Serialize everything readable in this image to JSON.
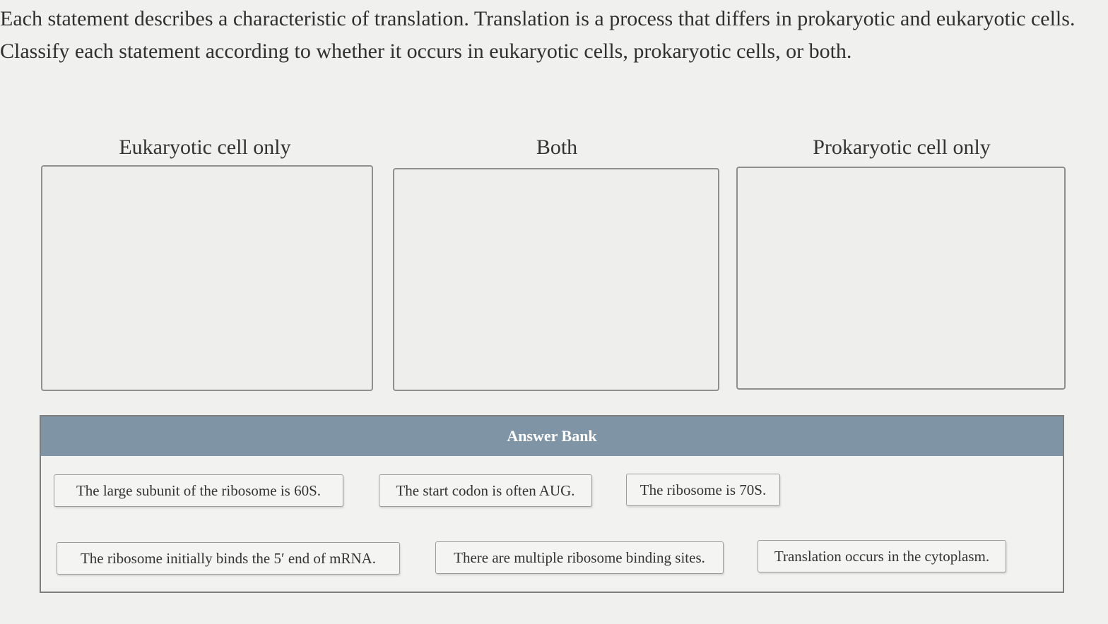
{
  "prompt": {
    "line1": "Each statement describes a characteristic of translation. Translation is a process that differs in prokaryotic and eukaryotic cells.",
    "line2": "Classify each statement according to whether it occurs in eukaryotic cells, prokaryotic cells, or both."
  },
  "bins": [
    {
      "label": "Eukaryotic cell only"
    },
    {
      "label": "Both"
    },
    {
      "label": "Prokaryotic cell only"
    }
  ],
  "answer_bank": {
    "title": "Answer Bank",
    "items": [
      {
        "text": "The large subunit of the ribosome is 60S."
      },
      {
        "text": "The start codon is often AUG."
      },
      {
        "text": "The ribosome is 70S."
      },
      {
        "text": "The ribosome initially binds the 5′ end of mRNA."
      },
      {
        "text": "There are multiple ribosome binding sites."
      },
      {
        "text": "Translation occurs in the cytoplasm."
      }
    ]
  },
  "colors": {
    "bank_header": "#7f95a6",
    "bin_border": "#8f8f8f",
    "background": "#f0f0ef"
  }
}
